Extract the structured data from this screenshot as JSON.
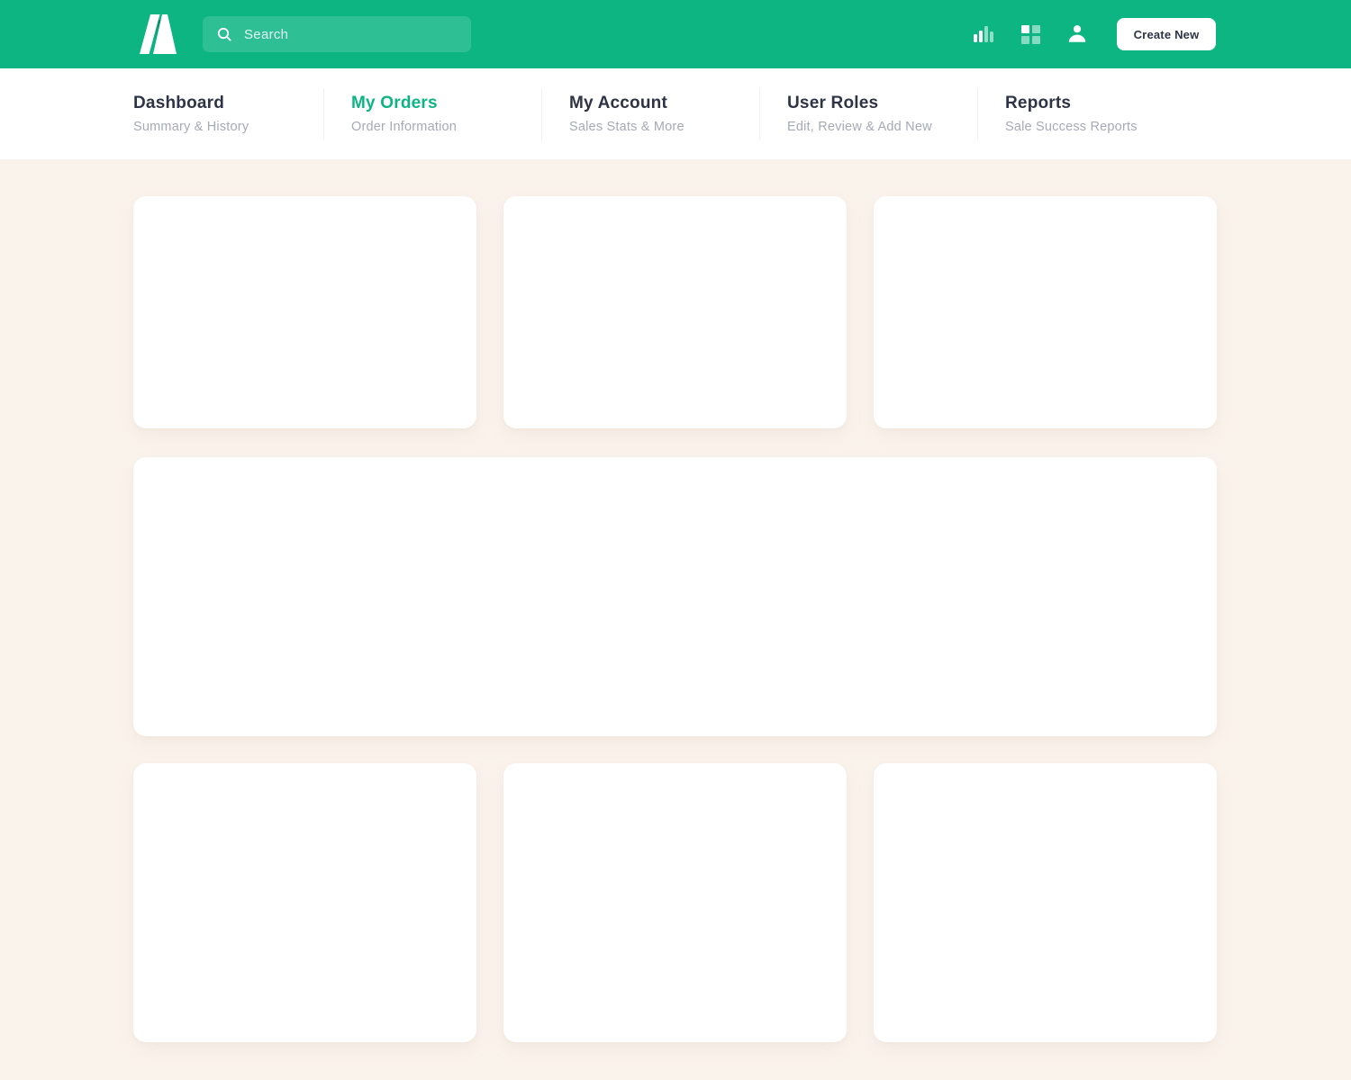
{
  "header": {
    "search": {
      "placeholder": "Search",
      "value": ""
    },
    "actions": {
      "create_button_label": "Create New"
    }
  },
  "nav": {
    "tabs": [
      {
        "label": "Dashboard",
        "sublabel": "Summary & History",
        "active": false
      },
      {
        "label": "My Orders",
        "sublabel": "Order Information",
        "active": true
      },
      {
        "label": "My Account",
        "sublabel": "Sales Stats & More",
        "active": false
      },
      {
        "label": "User Roles",
        "sublabel": "Edit, Review & Add New",
        "active": false
      },
      {
        "label": "Reports",
        "sublabel": "Sale Success Reports",
        "active": false
      }
    ]
  },
  "colors": {
    "accent_green": "#0db583",
    "page_background": "#faf3ec",
    "card_background": "#ffffff",
    "title_text": "#2e3446",
    "subtitle_text": "#a6aab6"
  }
}
